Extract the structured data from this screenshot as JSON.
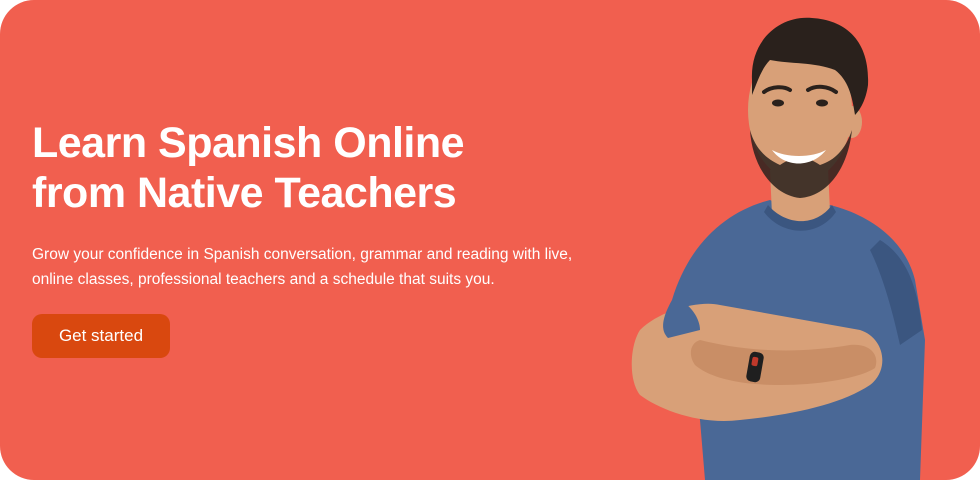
{
  "banner": {
    "background_color": "#F15F4F",
    "headline_line1": "Learn Spanish Online",
    "headline_line2": "from Native Teachers",
    "description": "Grow your confidence in Spanish conversation, grammar and reading with live, online classes, professional teachers and a schedule that suits you.",
    "cta": {
      "label": "Get started",
      "color": "#D9480F"
    }
  },
  "teacher_photo": {
    "icon": "smiling-teacher-arms-crossed",
    "shirt_color": "#4A6896",
    "skin_color": "#D8A078",
    "hair_color": "#2A211C"
  }
}
